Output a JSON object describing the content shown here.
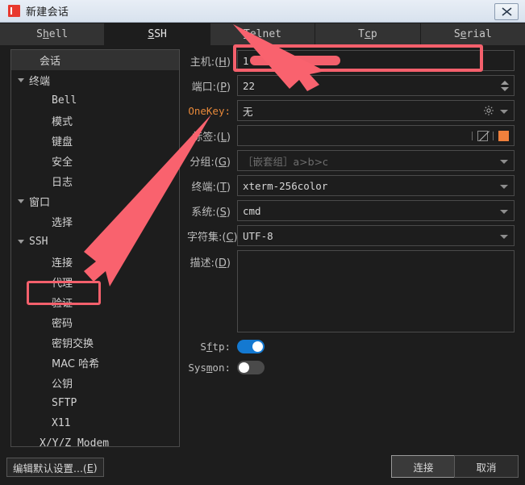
{
  "window": {
    "title": "新建会话",
    "icon": "app-icon",
    "close_label": "×"
  },
  "tabs": [
    {
      "label": "Shell",
      "mnemonic": "h",
      "active": false
    },
    {
      "label": "SSH",
      "mnemonic": "S",
      "active": true
    },
    {
      "label": "Telnet",
      "mnemonic": "T",
      "active": false
    },
    {
      "label": "Tcp",
      "mnemonic": "c",
      "active": false
    },
    {
      "label": "Serial",
      "mnemonic": "e",
      "active": false
    }
  ],
  "sidebar": {
    "items": [
      {
        "label": "会话",
        "level": "lvl0b",
        "expandable": false,
        "selected": true,
        "mono": false
      },
      {
        "label": "终端",
        "level": "lvl0",
        "expandable": true,
        "selected": false,
        "mono": false
      },
      {
        "label": "Bell",
        "level": "lvl1",
        "expandable": false,
        "selected": false,
        "mono": true
      },
      {
        "label": "模式",
        "level": "lvl1",
        "expandable": false,
        "selected": false,
        "mono": false
      },
      {
        "label": "键盘",
        "level": "lvl1",
        "expandable": false,
        "selected": false,
        "mono": false
      },
      {
        "label": "安全",
        "level": "lvl1",
        "expandable": false,
        "selected": false,
        "mono": false
      },
      {
        "label": "日志",
        "level": "lvl1",
        "expandable": false,
        "selected": false,
        "mono": false
      },
      {
        "label": "窗口",
        "level": "lvl0",
        "expandable": true,
        "selected": false,
        "mono": false
      },
      {
        "label": "选择",
        "level": "lvl1",
        "expandable": false,
        "selected": false,
        "mono": false
      },
      {
        "label": "SSH",
        "level": "lvl0",
        "expandable": true,
        "selected": false,
        "mono": true
      },
      {
        "label": "连接",
        "level": "lvl1",
        "expandable": false,
        "selected": false,
        "mono": false
      },
      {
        "label": "代理",
        "level": "lvl1",
        "expandable": false,
        "selected": false,
        "mono": false
      },
      {
        "label": "验证",
        "level": "lvl1",
        "expandable": false,
        "selected": false,
        "mono": false
      },
      {
        "label": "密码",
        "level": "lvl1",
        "expandable": false,
        "selected": false,
        "mono": false
      },
      {
        "label": "密钥交换",
        "level": "lvl1",
        "expandable": false,
        "selected": false,
        "mono": false
      },
      {
        "label": "MAC 哈希",
        "level": "lvl1",
        "expandable": false,
        "selected": false,
        "mono": false
      },
      {
        "label": "公钥",
        "level": "lvl1",
        "expandable": false,
        "selected": false,
        "mono": false
      },
      {
        "label": "SFTP",
        "level": "lvl1",
        "expandable": false,
        "selected": false,
        "mono": true
      },
      {
        "label": "X11",
        "level": "lvl1",
        "expandable": false,
        "selected": false,
        "mono": true
      },
      {
        "label": "X/Y/Z Modem",
        "level": "lvl0b",
        "expandable": false,
        "selected": false,
        "mono": true
      }
    ]
  },
  "form": {
    "host": {
      "label": "主机:(",
      "mnemonic": "H",
      "label_close": ")",
      "value": "1",
      "redacted": true
    },
    "port": {
      "label": "端口:(",
      "mnemonic": "P",
      "label_close": ")",
      "value": "22"
    },
    "onekey": {
      "label": "OneKey:",
      "value": "无"
    },
    "tag": {
      "label": "标签:(",
      "mnemonic": "L",
      "label_close": ")",
      "value": "",
      "swatch_color": "#f0803c"
    },
    "group": {
      "label": "分组:(",
      "mnemonic": "G",
      "label_close": ")",
      "placeholder": "［嵌套组］a>b>c",
      "value": ""
    },
    "terminal": {
      "label": "终端:(",
      "mnemonic": "T",
      "label_close": ")",
      "value": "xterm-256color"
    },
    "system": {
      "label": "系统:(",
      "mnemonic": "S",
      "label_close": ")",
      "value": "cmd"
    },
    "charset": {
      "label": "字符集:(",
      "mnemonic": "C",
      "label_close": ")",
      "value": "UTF-8"
    },
    "desc": {
      "label": "描述:(",
      "mnemonic": "D",
      "label_close": ")",
      "value": ""
    },
    "sftp": {
      "label": "Sftp:",
      "mnemonic": "f",
      "on": true
    },
    "sysmon": {
      "label": "Sysmon:",
      "mnemonic": "m",
      "on": false
    }
  },
  "footer": {
    "edit_defaults": {
      "pre": "编辑默认设置...(",
      "mnemonic": "E",
      "post": ")"
    },
    "connect": "连接",
    "cancel": "取消"
  },
  "colors": {
    "accent_orange": "#e8893a",
    "annotation_red": "#f4606c",
    "toggle_on": "#1479d1",
    "swatch": "#f0803c"
  }
}
